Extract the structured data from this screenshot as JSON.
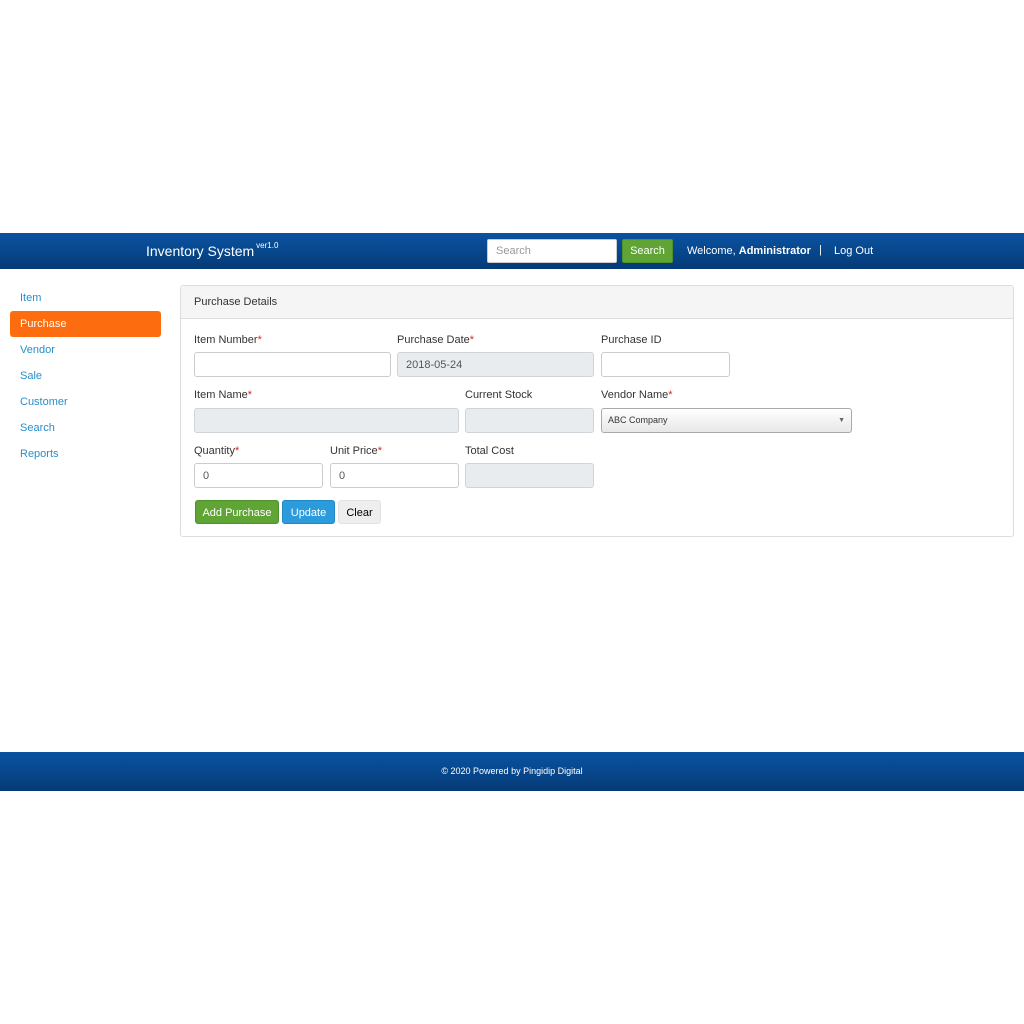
{
  "app": {
    "title": "Inventory System",
    "version": "ver1.0"
  },
  "navbar": {
    "search_placeholder": "Search",
    "search_button": "Search",
    "welcome_prefix": "Welcome,",
    "user_name": "Administrator",
    "separator": "|",
    "logout": "Log Out"
  },
  "sidebar": {
    "items": [
      {
        "label": "Item"
      },
      {
        "label": "Purchase",
        "active": true
      },
      {
        "label": "Vendor"
      },
      {
        "label": "Sale"
      },
      {
        "label": "Customer"
      },
      {
        "label": "Search"
      },
      {
        "label": "Reports"
      }
    ]
  },
  "panel": {
    "heading": "Purchase Details",
    "required_marker": "*",
    "fields": {
      "item_number": {
        "label": "Item Number",
        "required": true,
        "value": ""
      },
      "purchase_date": {
        "label": "Purchase Date",
        "required": true,
        "value": "2018-05-24"
      },
      "purchase_id": {
        "label": "Purchase ID",
        "required": false,
        "value": ""
      },
      "item_name": {
        "label": "Item Name",
        "required": true,
        "value": ""
      },
      "current_stock": {
        "label": "Current Stock",
        "required": false,
        "value": ""
      },
      "vendor_name": {
        "label": "Vendor Name",
        "required": true,
        "value": "ABC Company"
      },
      "quantity": {
        "label": "Quantity",
        "required": true,
        "value": "0"
      },
      "unit_price": {
        "label": "Unit Price",
        "required": true,
        "value": "0"
      },
      "total_cost": {
        "label": "Total Cost",
        "required": false,
        "value": ""
      }
    },
    "buttons": {
      "add": "Add Purchase",
      "update": "Update",
      "clear": "Clear"
    }
  },
  "footer": {
    "text": "© 2020 Powered by Pingidip Digital"
  },
  "colors": {
    "navbar": "#07468b",
    "active_nav": "#fd6c0e",
    "link": "#2a8ec8",
    "success": "#5fa435",
    "info": "#2b9bdb",
    "required": "#d9232d"
  },
  "icons": {
    "vendor_dropdown": "chevron-down-icon"
  }
}
